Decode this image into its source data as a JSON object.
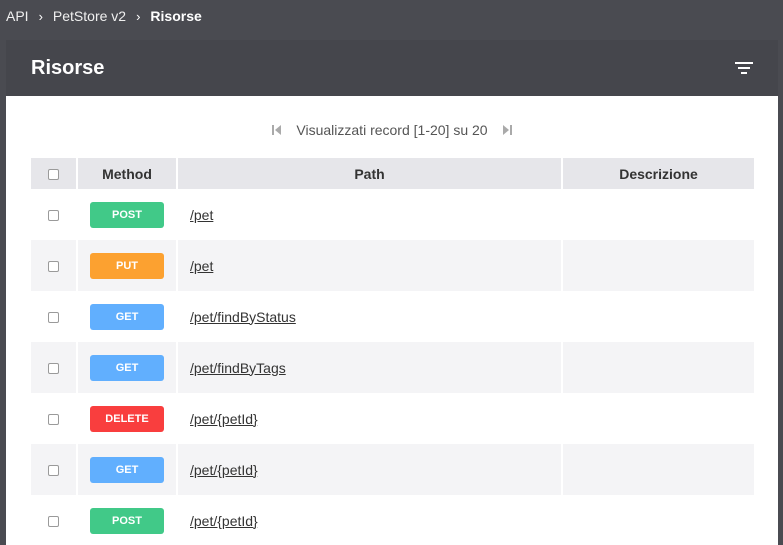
{
  "breadcrumb": {
    "items": [
      "API",
      "PetStore v2",
      "Risorse"
    ]
  },
  "panel": {
    "title": "Risorse",
    "filter_icon": "filter-list-icon"
  },
  "pagination": {
    "text": "Visualizzati record [1-20] su 20",
    "first_icon": "first-page-icon",
    "last_icon": "last-page-icon"
  },
  "table": {
    "headers": [
      "Method",
      "Path",
      "Descrizione"
    ],
    "rows": [
      {
        "method": "POST",
        "path": "/pet",
        "description": ""
      },
      {
        "method": "PUT",
        "path": "/pet",
        "description": ""
      },
      {
        "method": "GET",
        "path": "/pet/findByStatus",
        "description": ""
      },
      {
        "method": "GET",
        "path": "/pet/findByTags",
        "description": ""
      },
      {
        "method": "DELETE",
        "path": "/pet/{petId}",
        "description": ""
      },
      {
        "method": "GET",
        "path": "/pet/{petId}",
        "description": ""
      },
      {
        "method": "POST",
        "path": "/pet/{petId}",
        "description": ""
      }
    ]
  },
  "colors": {
    "POST": "#41c988",
    "PUT": "#fca130",
    "GET": "#61affe",
    "DELETE": "#f93e3e",
    "header_bg": "#45464c",
    "page_bg": "#4a4b51"
  }
}
